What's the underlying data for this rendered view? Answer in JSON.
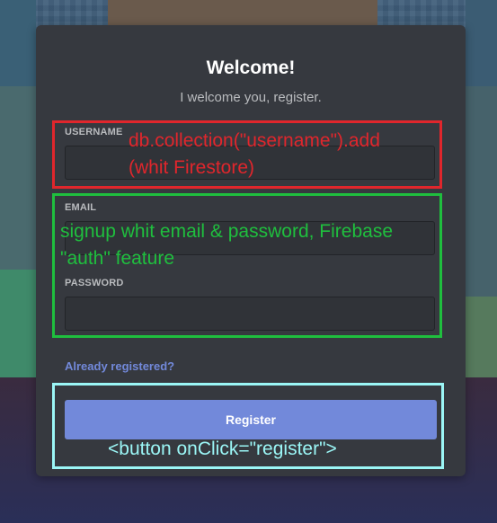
{
  "form": {
    "title": "Welcome!",
    "subtitle": "I welcome you, register.",
    "username_label": "USERNAME",
    "username_value": "",
    "email_label": "EMAIL",
    "email_value": "",
    "password_label": "PASSWORD",
    "password_value": "",
    "already_registered_link": "Already registered?",
    "register_button": "Register"
  },
  "annotations": {
    "username_note_line1": "db.collection(\"username\").add",
    "username_note_line2": "(whit Firestore)",
    "auth_note_line1": "signup whit email & password, Firebase",
    "auth_note_line2": "\"auth\" feature",
    "button_note": "<button onClick=\"register\">"
  },
  "colors": {
    "card_background": "#36393f",
    "accent": "#7289da",
    "annotation_red": "#e0262c",
    "annotation_green": "#1fbf3e",
    "annotation_cyan": "#9bf6f6"
  }
}
